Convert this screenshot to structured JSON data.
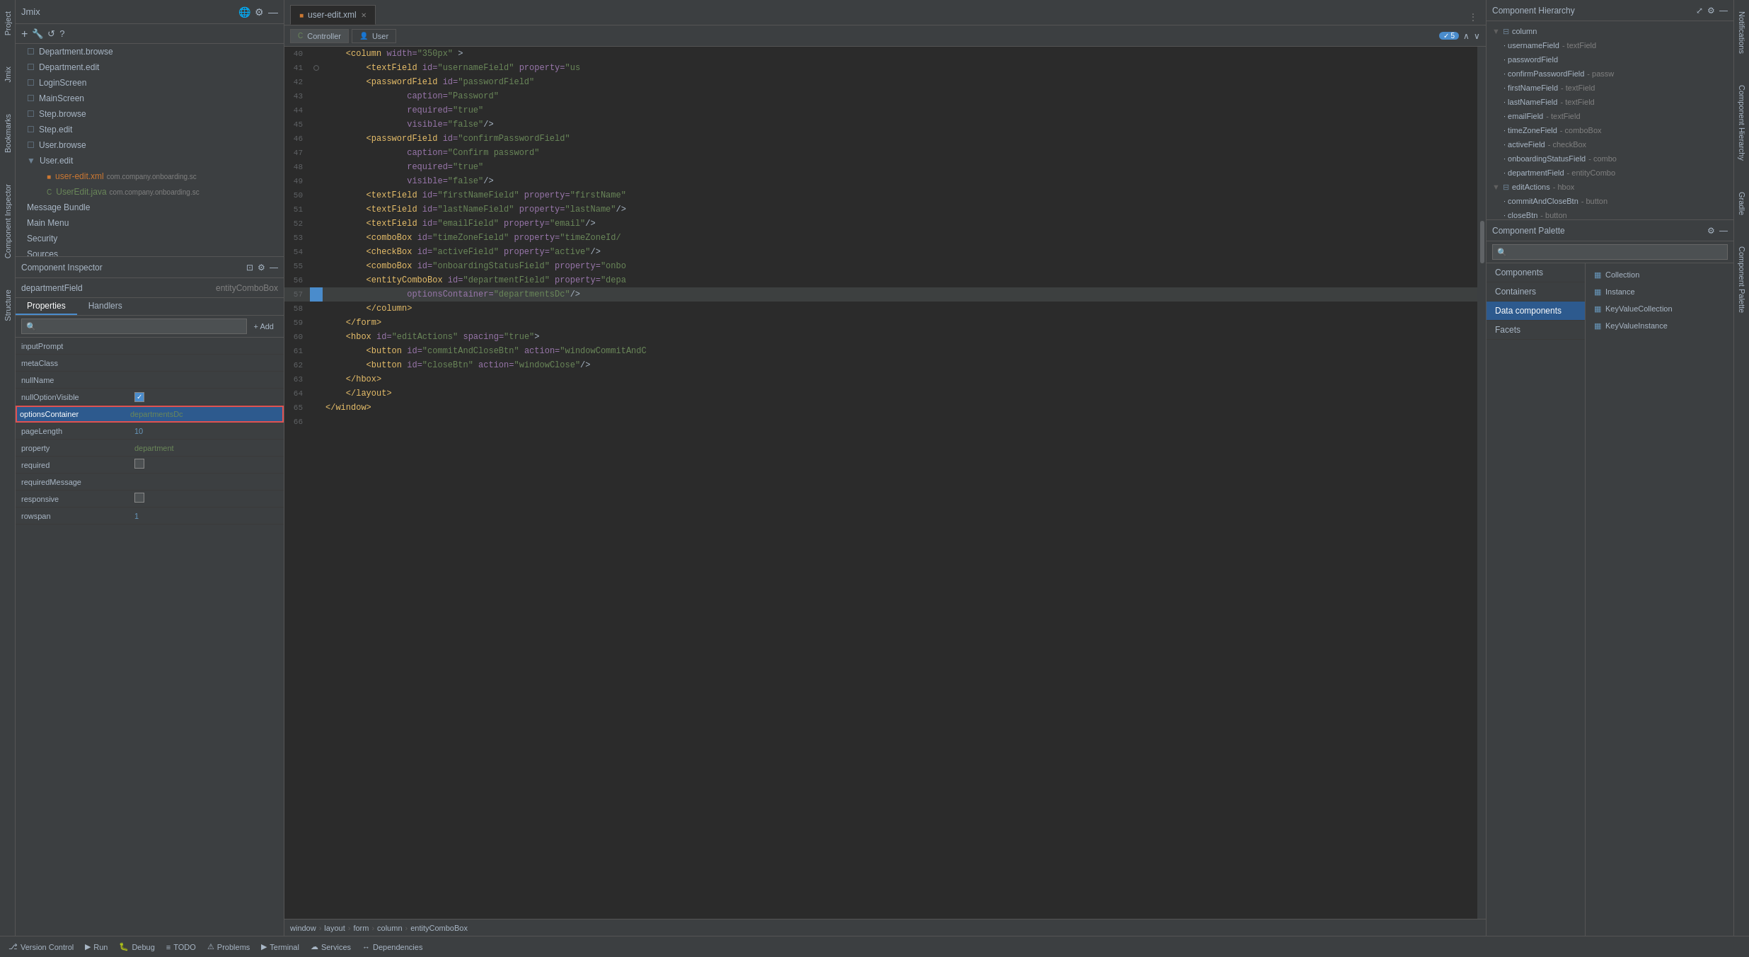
{
  "app": {
    "title": "Jmix"
  },
  "left_panel": {
    "toolbar_icons": [
      "+",
      "🔧",
      "↺",
      "?"
    ],
    "tree_items": [
      {
        "name": "Department.browse",
        "type": "file",
        "indent": 1
      },
      {
        "name": "Department.edit",
        "type": "file",
        "indent": 1
      },
      {
        "name": "LoginScreen",
        "type": "file",
        "indent": 1
      },
      {
        "name": "MainScreen",
        "type": "file",
        "indent": 1
      },
      {
        "name": "Step.browse",
        "type": "file",
        "indent": 1
      },
      {
        "name": "Step.edit",
        "type": "file",
        "indent": 1
      },
      {
        "name": "User.browse",
        "type": "file",
        "indent": 1
      },
      {
        "name": "User.edit",
        "type": "folder",
        "indent": 1,
        "expanded": true
      },
      {
        "name": "user-edit.xml",
        "type": "xml",
        "indent": 2,
        "pkg": "com.company.onboarding.sc"
      },
      {
        "name": "UserEdit.java",
        "type": "java",
        "indent": 2,
        "pkg": "com.company.onboarding.sc"
      },
      {
        "name": "Message Bundle",
        "type": "file",
        "indent": 1
      },
      {
        "name": "Main Menu",
        "type": "file",
        "indent": 1
      },
      {
        "name": "Security",
        "type": "file",
        "indent": 1
      },
      {
        "name": "Sources",
        "type": "file",
        "indent": 1
      }
    ]
  },
  "component_inspector": {
    "title": "Component Inspector",
    "selected_name": "departmentField",
    "selected_type": "entityComboBox",
    "tabs": [
      "Properties",
      "Handlers"
    ],
    "active_tab": "Properties",
    "search_placeholder": "🔍",
    "add_label": "+ Add",
    "properties": [
      {
        "name": "inputPrompt",
        "value": "",
        "type": "text"
      },
      {
        "name": "metaClass",
        "value": "",
        "type": "text"
      },
      {
        "name": "nullName",
        "value": "",
        "type": "text"
      },
      {
        "name": "nullOptionVisible",
        "value": "checked",
        "type": "checkbox",
        "checked": true
      },
      {
        "name": "optionsContainer",
        "value": "departmentsDc",
        "type": "text",
        "highlighted": true,
        "selected": true
      },
      {
        "name": "pageLength",
        "value": "10",
        "type": "text"
      },
      {
        "name": "property",
        "value": "department",
        "type": "text"
      },
      {
        "name": "required",
        "value": "",
        "type": "checkbox",
        "checked": false
      },
      {
        "name": "requiredMessage",
        "value": "",
        "type": "text"
      },
      {
        "name": "responsive",
        "value": "",
        "type": "checkbox",
        "checked": false
      },
      {
        "name": "rowspan",
        "value": "1",
        "type": "text"
      }
    ]
  },
  "editor": {
    "tab_name": "user-edit.xml",
    "controller_tab": "Controller",
    "user_tab": "User",
    "badge_count": "5",
    "lines": [
      {
        "num": "40",
        "content": "    <column width=\"350px\" >"
      },
      {
        "num": "41",
        "content": "        <textField id=\"usernameField\" property=\"us",
        "highlighted": false
      },
      {
        "num": "42",
        "content": "        <passwordField id=\"passwordField\""
      },
      {
        "num": "43",
        "content": "                caption=\"Password\""
      },
      {
        "num": "44",
        "content": "                required=\"true\""
      },
      {
        "num": "45",
        "content": "                visible=\"false\"/>"
      },
      {
        "num": "46",
        "content": "        <passwordField id=\"confirmPasswordField\""
      },
      {
        "num": "47",
        "content": "                caption=\"Confirm password\""
      },
      {
        "num": "48",
        "content": "                required=\"true\""
      },
      {
        "num": "49",
        "content": "                visible=\"false\"/>"
      },
      {
        "num": "50",
        "content": "        <textField id=\"firstNameField\" property=\"firstName\""
      },
      {
        "num": "51",
        "content": "        <textField id=\"lastNameField\" property=\"lastName\"/>"
      },
      {
        "num": "52",
        "content": "        <textField id=\"emailField\" property=\"email\"/>"
      },
      {
        "num": "53",
        "content": "        <comboBox id=\"timeZoneField\" property=\"timeZoneId/"
      },
      {
        "num": "54",
        "content": "        <checkBox id=\"activeField\" property=\"active\"/>"
      },
      {
        "num": "55",
        "content": "        <comboBox id=\"onboardingStatusField\" property=\"onbo"
      },
      {
        "num": "56",
        "content": "        <entityComboBox id=\"departmentField\" property=\"depa"
      },
      {
        "num": "57",
        "content": "                optionsContainer=\"departmentsDc\"/>",
        "highlighted": true
      },
      {
        "num": "58",
        "content": "        </column>"
      },
      {
        "num": "59",
        "content": "    </form>"
      },
      {
        "num": "60",
        "content": "    <hbox id=\"editActions\" spacing=\"true\">"
      },
      {
        "num": "61",
        "content": "        <button id=\"commitAndCloseBtn\" action=\"windowCommitAndC"
      },
      {
        "num": "62",
        "content": "        <button id=\"closeBtn\" action=\"windowClose\"/>"
      },
      {
        "num": "63",
        "content": "    </hbox>"
      },
      {
        "num": "64",
        "content": "    </layout>"
      },
      {
        "num": "65",
        "content": "</window>"
      },
      {
        "num": "66",
        "content": ""
      }
    ],
    "breadcrumb": [
      "window",
      "layout",
      "form",
      "column",
      "entityComboBox"
    ]
  },
  "component_hierarchy": {
    "title": "Component Hierarchy",
    "items": [
      {
        "name": "column",
        "type": "",
        "indent": 0,
        "expanded": true,
        "icon": "▼"
      },
      {
        "name": "usernameField",
        "type": "- textField",
        "indent": 1
      },
      {
        "name": "passwordField",
        "type": "",
        "indent": 1
      },
      {
        "name": "confirmPasswordField",
        "type": "- passw",
        "indent": 1
      },
      {
        "name": "firstNameField",
        "type": "- textField",
        "indent": 1
      },
      {
        "name": "lastNameField",
        "type": "- textField",
        "indent": 1
      },
      {
        "name": "emailField",
        "type": "- textField",
        "indent": 1
      },
      {
        "name": "timeZoneField",
        "type": "- comboBox",
        "indent": 1
      },
      {
        "name": "activeField",
        "type": "- checkBox",
        "indent": 1
      },
      {
        "name": "onboardingStatusField",
        "type": "- combo",
        "indent": 1
      },
      {
        "name": "departmentField",
        "type": "- entityCombo",
        "indent": 1
      },
      {
        "name": "editActions",
        "type": "- hbox",
        "indent": 0,
        "expanded": true,
        "icon": "▼"
      },
      {
        "name": "commitAndCloseBtn",
        "type": "- button",
        "indent": 1
      },
      {
        "name": "closeBtn",
        "type": "- button",
        "indent": 1
      }
    ]
  },
  "component_palette": {
    "title": "Component Palette",
    "search_placeholder": "🔍",
    "categories": [
      "Components",
      "Containers",
      "Data components",
      "Facets"
    ],
    "active_category": "Data components",
    "items": [
      {
        "name": "Collection",
        "icon": "▦"
      },
      {
        "name": "Instance",
        "icon": "▦"
      },
      {
        "name": "KeyValueCollection",
        "icon": "▦"
      },
      {
        "name": "KeyValueInstance",
        "icon": "▦"
      }
    ]
  },
  "status_bar": {
    "items": [
      {
        "icon": "⎇",
        "label": "Version Control"
      },
      {
        "icon": "▶",
        "label": "Run"
      },
      {
        "icon": "🐛",
        "label": "Debug"
      },
      {
        "icon": "≡",
        "label": "TODO"
      },
      {
        "icon": "⚠",
        "label": "Problems"
      },
      {
        "icon": "▶",
        "label": "Terminal"
      },
      {
        "icon": "☁",
        "label": "Services"
      },
      {
        "icon": "↔",
        "label": "Dependencies"
      }
    ]
  },
  "side_tabs": {
    "right": [
      "Notifications",
      "Component Hierarchy",
      "Gradle"
    ]
  }
}
